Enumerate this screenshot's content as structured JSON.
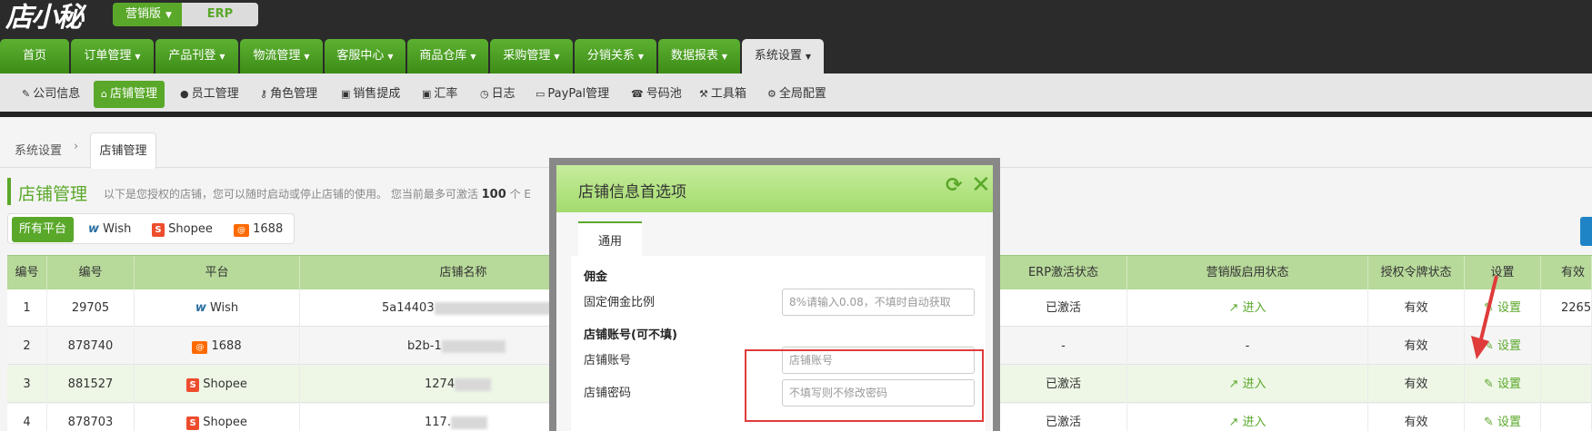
{
  "topbar": {
    "logo": "店小秘",
    "edition": "营销版",
    "erp": "ERP"
  },
  "mainnav": [
    "首页",
    "订单管理",
    "产品刊登",
    "物流管理",
    "客服中心",
    "商品仓库",
    "采购管理",
    "分销关系",
    "数据报表",
    "系统设置"
  ],
  "subnav": [
    "公司信息",
    "店铺管理",
    "员工管理",
    "角色管理",
    "销售提成",
    "汇率",
    "日志",
    "PayPal管理",
    "号码池",
    "工具箱",
    "全局配置"
  ],
  "breadcrumb": {
    "root": "系统设置",
    "current": "店铺管理"
  },
  "page": {
    "title": "店铺管理",
    "desc_prefix": "以下是您授权的店铺，您可以随时启动或停止店铺的使用。 您当前最多可激活 ",
    "desc_count": "100",
    "desc_suffix": " 个 E"
  },
  "filter": {
    "all": "所有平台",
    "wish": "Wish",
    "shopee": "Shopee",
    "p1688": "1688"
  },
  "table": {
    "headers": [
      "编号",
      "编号",
      "平台",
      "店铺名称",
      "ERP激活状态",
      "营销版启用状态",
      "授权令牌状态",
      "设置",
      "有效"
    ],
    "rows": [
      {
        "idx": "1",
        "id": "29705",
        "platform": "Wish",
        "name": "5a14403",
        "erp": "已激活",
        "marketing": "进入",
        "token": "有效",
        "setting": "设置",
        "extra": "2265"
      },
      {
        "idx": "2",
        "id": "878740",
        "platform": "1688",
        "name": "b2b-1",
        "erp": "-",
        "marketing": "-",
        "token": "有效",
        "setting": "设置",
        "extra": ""
      },
      {
        "idx": "3",
        "id": "881527",
        "platform": "Shopee",
        "name": "1274",
        "erp": "已激活",
        "marketing": "进入",
        "token": "有效",
        "setting": "设置",
        "extra": ""
      },
      {
        "idx": "4",
        "id": "878703",
        "platform": "Shopee",
        "name": "117.",
        "erp": "已激活",
        "marketing": "进入",
        "token": "有效",
        "setting": "设置",
        "extra": ""
      }
    ]
  },
  "modal": {
    "title": "店铺信息首选项",
    "tab": "通用",
    "commission_section": "佣金",
    "commission_label": "固定佣金比例",
    "commission_placeholder": "8%请输入0.08，不填时自动获取",
    "account_section": "店铺账号(可不填)",
    "account_label": "店铺账号",
    "account_placeholder": "店铺账号",
    "password_label": "店铺密码",
    "password_placeholder": "不填写则不修改密码"
  },
  "colors": {
    "brand_green": "#5aa82a",
    "header_green": "#b7d99a",
    "highlight_red": "#e03b3b"
  }
}
